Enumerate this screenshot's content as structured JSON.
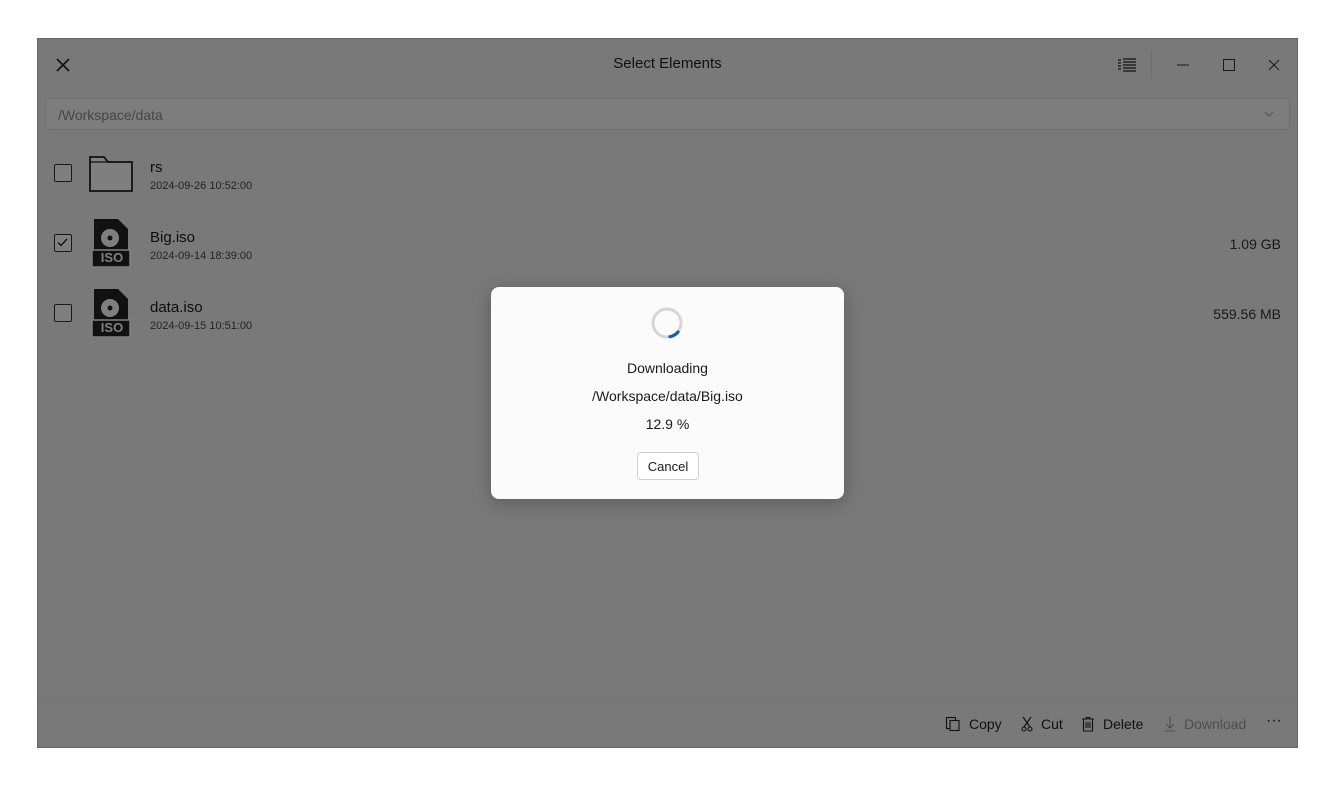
{
  "window": {
    "title": "Select Elements",
    "path": "/Workspace/data"
  },
  "titlebar_icons": {
    "close": "close-icon",
    "view": "list-view-icon",
    "minimize": "minimize-icon",
    "maximize": "maximize-icon",
    "window_close": "window-close-icon"
  },
  "files": [
    {
      "name": "rs",
      "date": "2024-09-26 10:52:00",
      "size": "",
      "icon": "folder-icon",
      "checked": false
    },
    {
      "name": "Big.iso",
      "date": "2024-09-14 18:39:00",
      "size": "1.09 GB",
      "icon": "iso-file-icon",
      "checked": true
    },
    {
      "name": "data.iso",
      "date": "2024-09-15 10:51:00",
      "size": "559.56 MB",
      "icon": "iso-file-icon",
      "checked": false
    }
  ],
  "iso_badge": "ISO",
  "actions": {
    "copy": "Copy",
    "cut": "Cut",
    "delete": "Delete",
    "download": "Download",
    "more": "···"
  },
  "dialog": {
    "status": "Downloading",
    "file": "/Workspace/data/Big.iso",
    "progress": "12.9 %",
    "cancel": "Cancel"
  },
  "colors": {
    "accent": "#0f5fb5",
    "overlay": "rgba(0,0,0,0.5)"
  }
}
